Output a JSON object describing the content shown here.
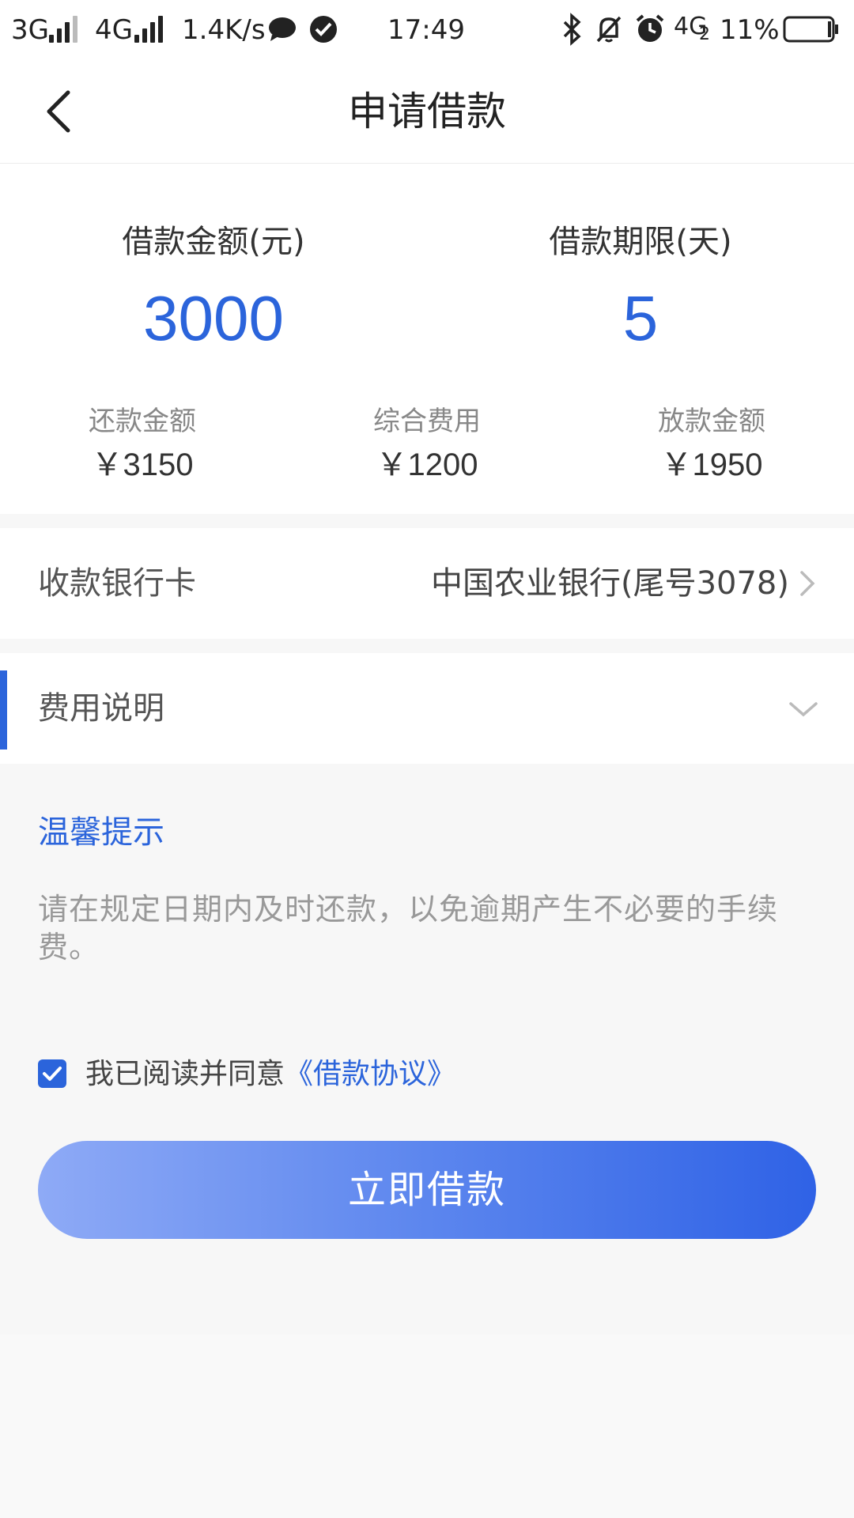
{
  "status_bar": {
    "net1": "3G",
    "net2": "4G",
    "speed": "1.4K/s",
    "time": "17:49",
    "net3": "4G",
    "net3_sub": "2",
    "battery": "11%"
  },
  "nav": {
    "title": "申请借款"
  },
  "summary": {
    "amount_label": "借款金额(元)",
    "amount_value": "3000",
    "term_label": "借款期限(天)",
    "term_value": "5",
    "repay_label": "还款金额",
    "repay_value": "￥3150",
    "fee_label": "综合费用",
    "fee_value": "￥1200",
    "disburse_label": "放款金额",
    "disburse_value": "￥1950"
  },
  "bank": {
    "label": "收款银行卡",
    "value": "中国农业银行(尾号3078)"
  },
  "fee_section": {
    "label": "费用说明"
  },
  "tips": {
    "title": "温馨提示",
    "body": "请在规定日期内及时还款，以免逾期产生不必要的手续费。"
  },
  "agreement": {
    "text": "我已阅读并同意",
    "link": "《借款协议》",
    "checked": true
  },
  "submit": {
    "label": "立即借款"
  },
  "colors": {
    "accent": "#2b64db",
    "button_start": "#8eaaf6",
    "button_end": "#2f62e6"
  }
}
